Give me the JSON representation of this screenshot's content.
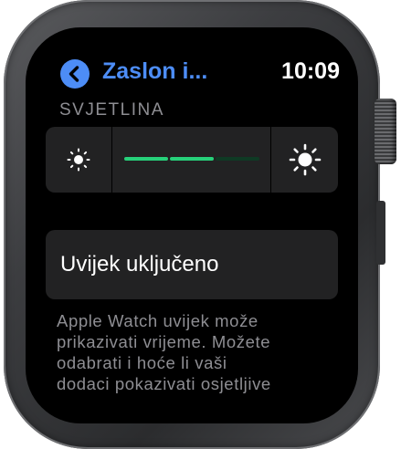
{
  "header": {
    "back_label": "back",
    "title": "Zaslon i...",
    "time": "10:09"
  },
  "brightness": {
    "section_title": "SVJETLINA",
    "level_fraction": 0.67,
    "segments": 3,
    "active_color": "#27d17a",
    "inactive_color": "#0f3a24",
    "decrease_icon": "sun-small-icon",
    "increase_icon": "sun-large-icon"
  },
  "always_on": {
    "label": "Uvijek uključeno"
  },
  "description": {
    "lines": [
      "Apple Watch uvijek može",
      "prikazivati vrijeme. Možete",
      "odabrati i hoće li vaši",
      "dodaci pokazivati osjetljive"
    ]
  },
  "colors": {
    "accent": "#4d8df6",
    "screen": "#000000",
    "panel": "#222223",
    "secondary_text": "#8e8e93"
  }
}
